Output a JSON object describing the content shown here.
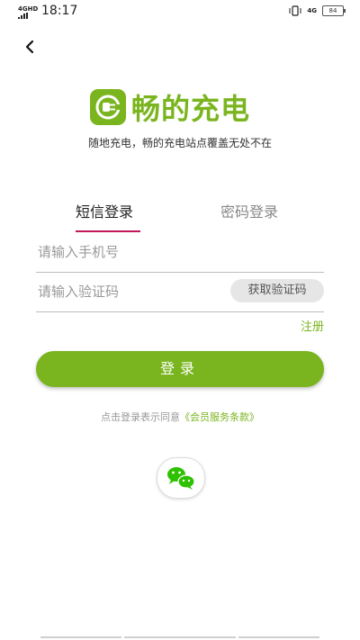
{
  "status_bar": {
    "network": "4GHD",
    "time": "18:17",
    "right_network": "4G",
    "battery": "84"
  },
  "app": {
    "name": "畅的充电",
    "slogan": "随地充电，畅的充电站点覆盖无处不在"
  },
  "tabs": [
    {
      "label": "短信登录",
      "active": true
    },
    {
      "label": "密码登录",
      "active": false
    }
  ],
  "form": {
    "phone_placeholder": "请输入手机号",
    "code_placeholder": "请输入验证码",
    "get_code_label": "获取验证码",
    "register_label": "注册",
    "login_label": "登录"
  },
  "agreement": {
    "prefix": "点击登录表示同意",
    "link": "《会员服务条款》"
  },
  "colors": {
    "brand": "#7ab51f",
    "tab_underline": "#c2185b"
  }
}
